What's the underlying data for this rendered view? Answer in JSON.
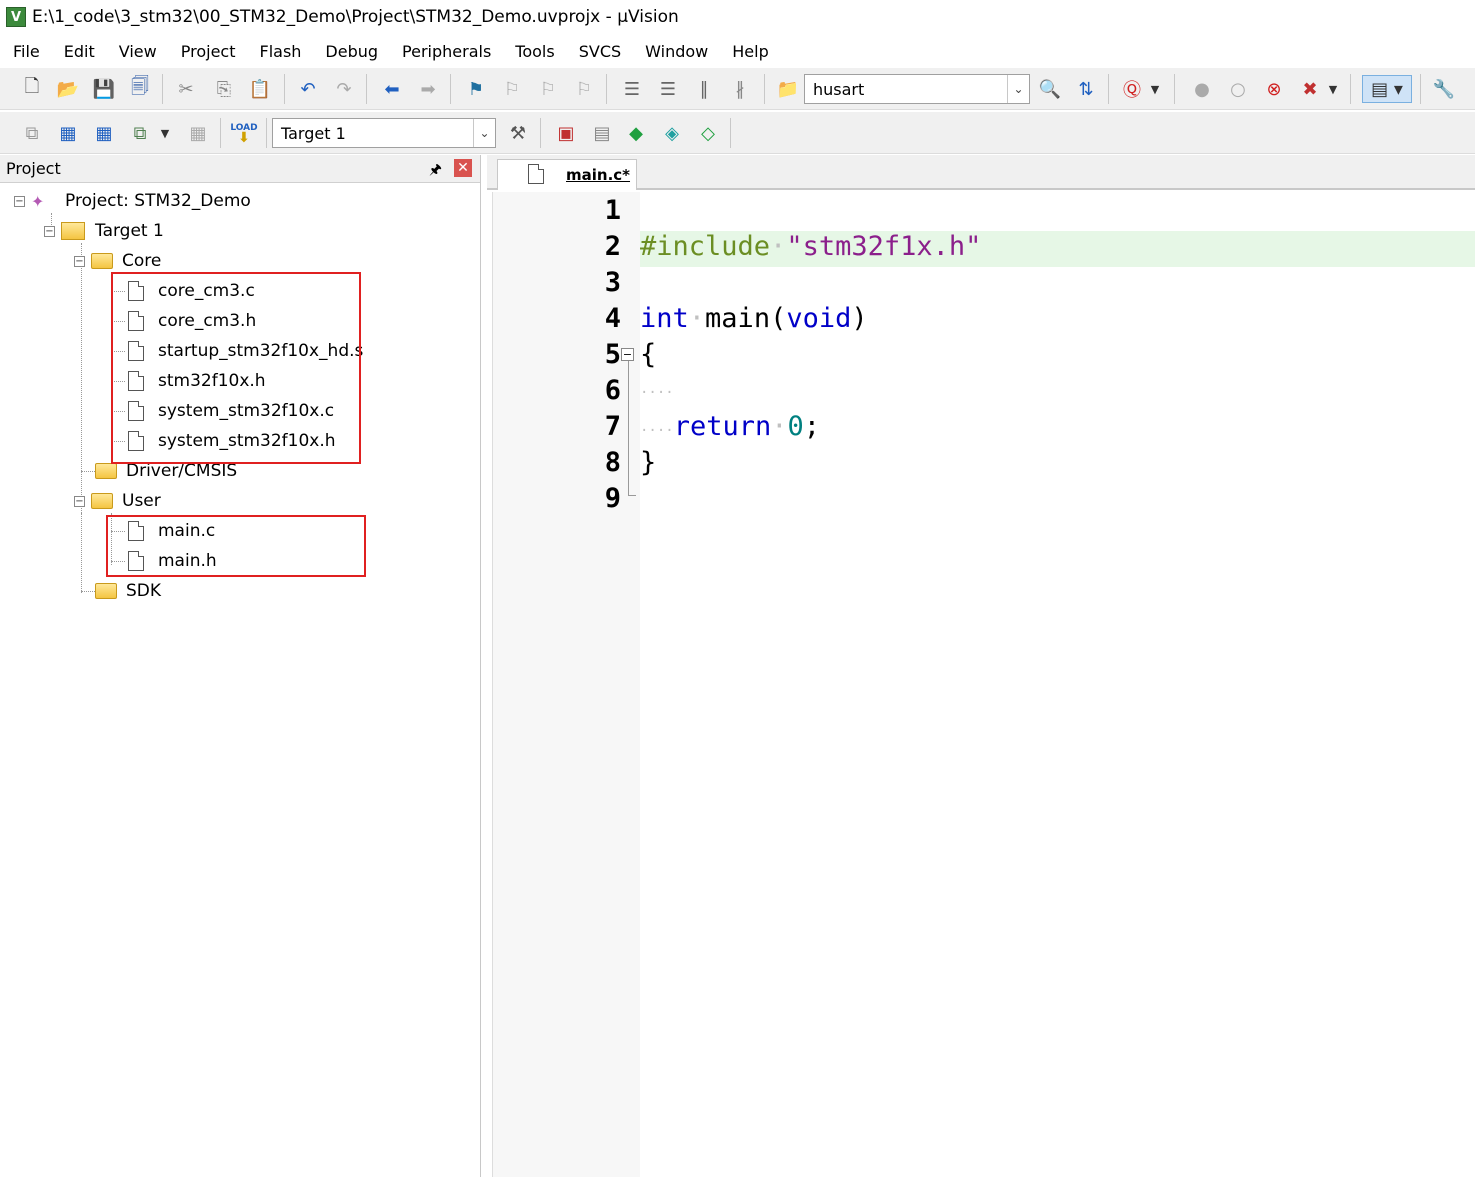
{
  "window": {
    "title": "E:\\1_code\\3_stm32\\00_STM32_Demo\\Project\\STM32_Demo.uvprojx - µVision",
    "icon_label": "V"
  },
  "menu": [
    "File",
    "Edit",
    "View",
    "Project",
    "Flash",
    "Debug",
    "Peripherals",
    "Tools",
    "SVCS",
    "Window",
    "Help"
  ],
  "toolbar1": {
    "find_combo_value": "husart"
  },
  "toolbar2": {
    "target_combo_value": "Target 1",
    "load_label": "LOAD"
  },
  "project_panel": {
    "title": "Project",
    "project": "Project: STM32_Demo",
    "target": "Target 1",
    "groups": [
      {
        "name": "Core",
        "files": [
          "core_cm3.c",
          "core_cm3.h",
          "startup_stm32f10x_hd.s",
          "stm32f10x.h",
          "system_stm32f10x.c",
          "system_stm32f10x.h"
        ]
      },
      {
        "name": "Driver/CMSIS",
        "files": []
      },
      {
        "name": "User",
        "files": [
          "main.c",
          "main.h"
        ]
      },
      {
        "name": "SDK",
        "files": []
      }
    ]
  },
  "editor": {
    "tab_label": "main.c*",
    "line_numbers": [
      "1",
      "2",
      "3",
      "4",
      "5",
      "6",
      "7",
      "8",
      "9"
    ],
    "code": {
      "l2_directive": "#include",
      "l2_header": "\"stm32f1x.h\"",
      "l4_type": "int",
      "l4_name": "main(",
      "l4_param": "void",
      "l4_close": ")",
      "l5_brace": "{",
      "l6_indent": "····",
      "l7_indent": "····",
      "l7_keyword": "return",
      "l7_value": "0",
      "l7_semicolon": ";",
      "l8_brace": "}"
    }
  },
  "colors": {
    "highlight_line": "#e6f7e6",
    "redbox": "#e02020",
    "keyword": "#0000c8",
    "string": "#8b1f8b",
    "preprocessor": "#6b8e23",
    "number": "#008080"
  }
}
